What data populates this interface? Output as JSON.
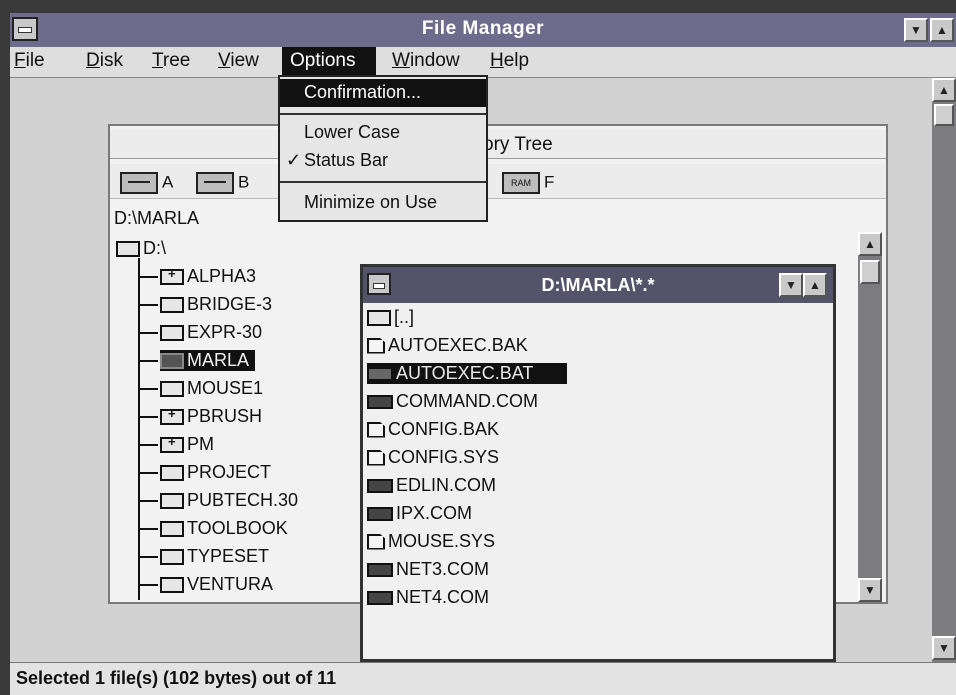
{
  "window": {
    "title": "File Manager"
  },
  "menubar": [
    {
      "label": "File",
      "key": "F"
    },
    {
      "label": "Disk",
      "key": "D"
    },
    {
      "label": "Tree",
      "key": "T"
    },
    {
      "label": "View",
      "key": "V"
    },
    {
      "label": "Options",
      "key": "O"
    },
    {
      "label": "Window",
      "key": "W"
    },
    {
      "label": "Help",
      "key": "H"
    }
  ],
  "options_menu": {
    "items": [
      {
        "label": "Confirmation...",
        "highlighted": true
      },
      {
        "label": "Lower Case"
      },
      {
        "label": "Status Bar",
        "checked": true,
        "check": "✓"
      },
      {
        "label": "Minimize on Use"
      }
    ]
  },
  "tree_window": {
    "title": "ory Tree",
    "drives": [
      "A",
      "B",
      "F"
    ],
    "ram_label": "RAM",
    "path": "D:\\MARLA",
    "root": "D:\\",
    "folders": [
      {
        "name": "ALPHA3",
        "expandable": true
      },
      {
        "name": "BRIDGE-3"
      },
      {
        "name": "EXPR-30"
      },
      {
        "name": "MARLA",
        "selected": true
      },
      {
        "name": "MOUSE1"
      },
      {
        "name": "PBRUSH",
        "expandable": true
      },
      {
        "name": "PM",
        "expandable": true
      },
      {
        "name": "PROJECT"
      },
      {
        "name": "PUBTECH.30"
      },
      {
        "name": "TOOLBOOK"
      },
      {
        "name": "TYPESET"
      },
      {
        "name": "VENTURA"
      }
    ]
  },
  "dir_window": {
    "title": "D:\\MARLA\\*.*",
    "files": [
      {
        "name": "[..]",
        "icon": "up-folder-icon"
      },
      {
        "name": "AUTOEXEC.BAK",
        "icon": "document-icon"
      },
      {
        "name": "AUTOEXEC.BAT",
        "icon": "program-icon",
        "selected": true
      },
      {
        "name": "COMMAND.COM",
        "icon": "program-icon"
      },
      {
        "name": "CONFIG.BAK",
        "icon": "document-icon"
      },
      {
        "name": "CONFIG.SYS",
        "icon": "document-icon"
      },
      {
        "name": "EDLIN.COM",
        "icon": "program-icon"
      },
      {
        "name": "IPX.COM",
        "icon": "program-icon"
      },
      {
        "name": "MOUSE.SYS",
        "icon": "document-icon"
      },
      {
        "name": "NET3.COM",
        "icon": "program-icon"
      },
      {
        "name": "NET4.COM",
        "icon": "program-icon"
      }
    ]
  },
  "status_bar": {
    "text": "Selected 1 file(s) (102 bytes) out of 11"
  },
  "colors": {
    "titlebar": "#6f6b8c",
    "selection": "#111111",
    "client": "#d2d2d2"
  }
}
